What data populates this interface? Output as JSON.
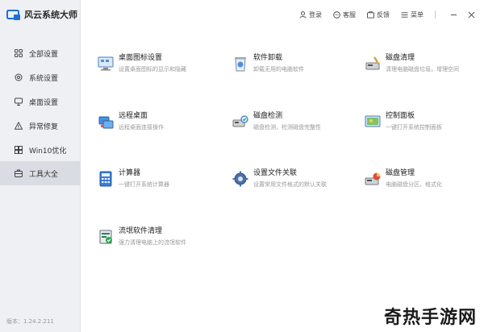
{
  "app": {
    "title": "风云系统大师",
    "version": "版本：1.24.2.211"
  },
  "topbar": {
    "login": "登录",
    "service": "客服",
    "feedback": "反馈",
    "menu": "菜单"
  },
  "sidebar": {
    "items": [
      {
        "label": "全部设置",
        "icon": "grid-icon"
      },
      {
        "label": "系统设置",
        "icon": "gear-icon"
      },
      {
        "label": "桌面设置",
        "icon": "monitor-icon"
      },
      {
        "label": "异常修复",
        "icon": "warning-icon"
      },
      {
        "label": "Win10优化",
        "icon": "windows-icon"
      },
      {
        "label": "工具大全",
        "icon": "toolbox-icon",
        "active": true
      }
    ]
  },
  "tools": [
    {
      "title": "桌面图标设置",
      "desc": "设置桌面图标的显示和隐藏",
      "icon": "desktop-icons-icon"
    },
    {
      "title": "软件卸载",
      "desc": "卸载无用的电脑软件",
      "icon": "uninstall-icon"
    },
    {
      "title": "磁盘清理",
      "desc": "清理电脑磁盘垃圾，增理空间",
      "icon": "disk-clean-icon"
    },
    {
      "title": "远程桌面",
      "desc": "远程桌面连接操作",
      "icon": "remote-desktop-icon"
    },
    {
      "title": "磁盘检测",
      "desc": "磁盘检测，检测磁盘完整性",
      "icon": "disk-check-icon"
    },
    {
      "title": "控制面板",
      "desc": "一键打开系统控制面板",
      "icon": "control-panel-icon"
    },
    {
      "title": "计算器",
      "desc": "一键打开系统计算器",
      "icon": "calculator-icon"
    },
    {
      "title": "设置文件关联",
      "desc": "设置常用文件格式的默认关联",
      "icon": "file-association-icon"
    },
    {
      "title": "磁盘管理",
      "desc": "电脑磁盘分区，格式化",
      "icon": "disk-manage-icon"
    },
    {
      "title": "流氓软件清理",
      "desc": "强力清理电脑上的流氓软件",
      "icon": "malware-clean-icon"
    }
  ],
  "watermark": "奇热手游网",
  "colors": {
    "accent": "#1e6fd9",
    "sidebar_bg": "#eef0f3",
    "sidebar_active": "#d9dde3"
  }
}
